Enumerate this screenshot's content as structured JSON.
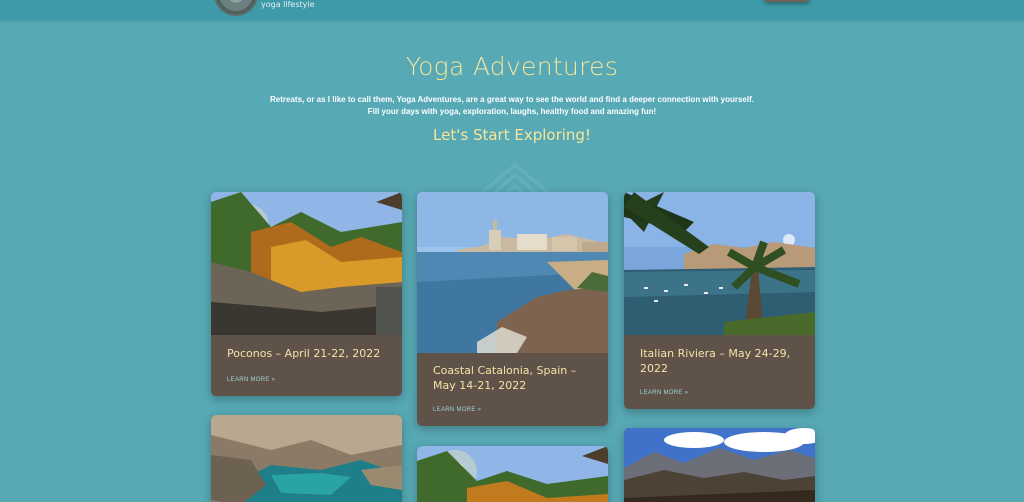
{
  "header": {
    "tagline": "yoga lifestyle"
  },
  "hero": {
    "title": "Yoga Adventures",
    "intro_line1": "Retreats, or as I like to call them, Yoga Adventures, are a great way to see the world and find a deeper connection with yourself.",
    "intro_line2": "Fill your days with yoga, exploration, laughs, healthy food and amazing fun!",
    "subtitle": "Let's Start Exploring!"
  },
  "cards": [
    {
      "title": "Poconos – April 21-22, 2022",
      "more": "LEARN MORE »",
      "image": "autumn-forest-creek-photo"
    },
    {
      "title": "Coastal Catalonia, Spain – May 14-21, 2022",
      "more": "LEARN MORE »",
      "image": "coastal-town-photo"
    },
    {
      "title": "Italian Riviera – May 24-29, 2022",
      "more": "LEARN MORE »",
      "image": "harbor-palm-photo"
    },
    {
      "title": "",
      "more": "",
      "image": "aerial-coast-photo"
    },
    {
      "title": "",
      "more": "",
      "image": "autumn-forest-photo"
    },
    {
      "title": "",
      "more": "",
      "image": "mountain-range-photo"
    }
  ],
  "colors": {
    "background": "#57a9b6",
    "topbar": "#3e9aa9",
    "card": "#5f5249",
    "accent_yellow": "#f6e59a",
    "link": "#9fd3da"
  }
}
